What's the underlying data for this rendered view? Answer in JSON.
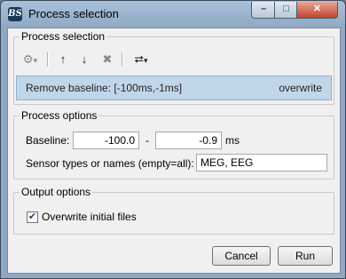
{
  "window": {
    "title": "Process selection",
    "app_icon_text": "BS",
    "controls": {
      "minimize": "–",
      "maximize": "□",
      "close": "✕"
    }
  },
  "process_selection": {
    "group_title": "Process selection",
    "toolbar": {
      "icons": [
        "gear-icon",
        "arrow-up-icon",
        "arrow-down-icon",
        "delete-icon",
        "pipeline-icon"
      ],
      "gear_glyph": "⚙",
      "gear_caret": "▾",
      "up_glyph": "↑",
      "down_glyph": "↓",
      "delete_glyph": "✖",
      "pipeline_glyph": "⮂",
      "pipeline_caret": "▾"
    },
    "items": [
      {
        "name": "Remove baseline: [-100ms,-1ms]",
        "mode": "overwrite"
      }
    ]
  },
  "process_options": {
    "group_title": "Process options",
    "baseline_label": "Baseline:",
    "baseline_start": "-100.0",
    "range_separator": "-",
    "baseline_end": "-0.9",
    "baseline_unit": "ms",
    "sensor_label": "Sensor types or names (empty=all):",
    "sensor_value": "MEG, EEG"
  },
  "output_options": {
    "group_title": "Output options",
    "overwrite_label": "Overwrite initial files",
    "overwrite_checked": true,
    "check_glyph": "✔"
  },
  "buttons": {
    "cancel": "Cancel",
    "run": "Run"
  }
}
